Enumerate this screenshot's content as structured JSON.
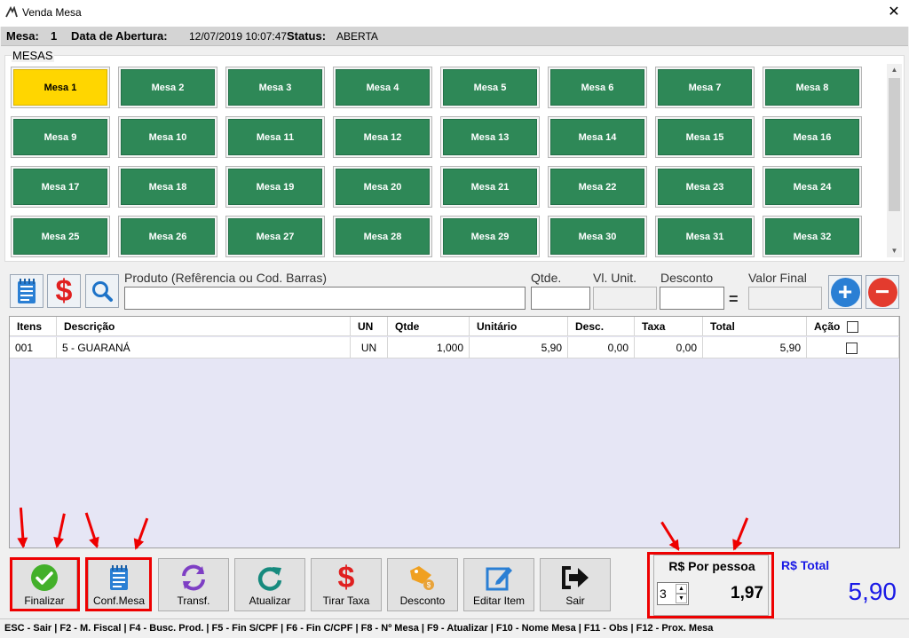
{
  "window": {
    "title": "Venda Mesa",
    "close": "✕"
  },
  "info": {
    "mesa_label": "Mesa:",
    "mesa_value": "1",
    "abertura_label": "Data de Abertura:",
    "abertura_value": "12/07/2019 10:07:47",
    "status_label": "Status:",
    "status_value": "ABERTA"
  },
  "mesas": {
    "legend": "MESAS",
    "selected": "Mesa 1",
    "items": [
      "Mesa 1",
      "Mesa 2",
      "Mesa 3",
      "Mesa 4",
      "Mesa 5",
      "Mesa 6",
      "Mesa 7",
      "Mesa 8",
      "Mesa 9",
      "Mesa 10",
      "Mesa 11",
      "Mesa 12",
      "Mesa 13",
      "Mesa 14",
      "Mesa 15",
      "Mesa 16",
      "Mesa 17",
      "Mesa 18",
      "Mesa 19",
      "Mesa 20",
      "Mesa 21",
      "Mesa 22",
      "Mesa 23",
      "Mesa 24",
      "Mesa 25",
      "Mesa 26",
      "Mesa 27",
      "Mesa 28",
      "Mesa 29",
      "Mesa 30",
      "Mesa 31",
      "Mesa 32"
    ],
    "colors": {
      "free": "#2e8857",
      "selected": "#ffd600"
    }
  },
  "produto": {
    "produto_label": "Produto (Refêrencia ou Cod. Barras)",
    "qtde_label": "Qtde.",
    "vl_unit_label": "Vl. Unit.",
    "desconto_label": "Desconto",
    "equals": "=",
    "valor_final_label": "Valor Final",
    "add_symbol": "+",
    "remove_symbol": "−",
    "dollar": "$"
  },
  "table": {
    "headers": {
      "itens": "Itens",
      "descricao": "Descrição",
      "un": "UN",
      "qtde": "Qtde",
      "unitario": "Unitário",
      "desc": "Desc.",
      "taxa": "Taxa",
      "total": "Total",
      "acao": "Ação"
    },
    "rows": [
      {
        "itens": "001",
        "descricao": "5 - GUARANÁ",
        "un": "UN",
        "qtde": "1,000",
        "unitario": "5,90",
        "desc": "0,00",
        "taxa": "0,00",
        "total": "5,90"
      }
    ]
  },
  "buttons": {
    "finalizar": "Finalizar",
    "conf_mesa": "Conf.Mesa",
    "transf": "Transf.",
    "atualizar": "Atualizar",
    "tirar_taxa": "Tirar Taxa",
    "desconto": "Desconto",
    "editar_item": "Editar Item",
    "sair": "Sair",
    "dollar": "$"
  },
  "totals": {
    "por_pessoa_label": "R$ Por pessoa",
    "pessoas": "3",
    "por_pessoa_value": "1,97",
    "total_label": "R$ Total",
    "total_value": "5,90",
    "accent": "#1a1ae6"
  },
  "statusbar": "ESC - Sair | F2 - M. Fiscal | F4 - Busc. Prod. | F5 - Fin S/CPF | F6 - Fin C/CPF | F8 - Nº Mesa | F9 - Atualizar | F10 - Nome Mesa | F11 - Obs | F12 - Prox. Mesa"
}
